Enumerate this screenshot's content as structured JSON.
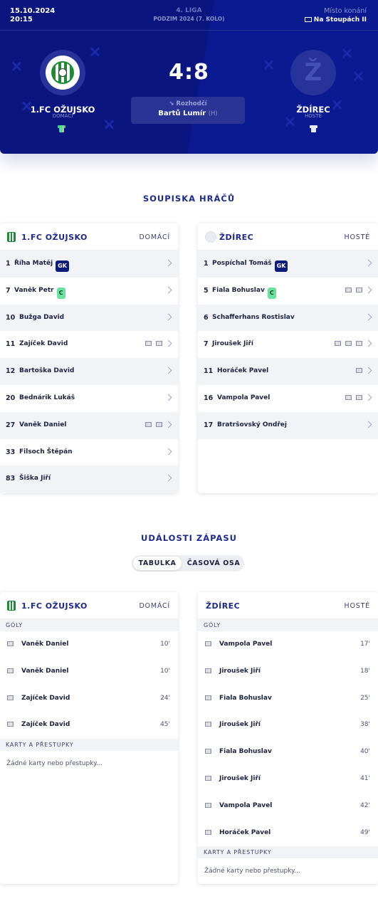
{
  "match": {
    "date": "15.10.2024",
    "time": "20:15",
    "league": "4. LIGA",
    "season": "PODZIM 2024 (7. KOLO)",
    "venue_label": "Místo konání",
    "venue": "Na Stoupách II",
    "score": "4:8",
    "referee_label": "Rozhodčí",
    "referee_name": "Bartů Lumír",
    "referee_role": "(H)",
    "home_name": "1.FC OŽUJSKO",
    "home_role": "DOMÁCÍ",
    "away_name": "ŽDÍREC",
    "away_role": "HOSTÉ",
    "away_logo_letter": "Ž",
    "colors": {
      "header_bg": "#0a1580",
      "accent": "#1c2a8c",
      "gk_badge": "#0f1b7a",
      "captain_badge": "#69e2a0"
    }
  },
  "lineups": {
    "title": "SOUPISKA HRÁČŮ",
    "home": {
      "title": "1.FC OŽUJSKO",
      "side": "DOMÁCÍ",
      "players": [
        {
          "num": "1",
          "name": "Říha Matěj",
          "tag": "GK",
          "goals": 0
        },
        {
          "num": "7",
          "name": "Vaněk Petr",
          "tag": "C",
          "goals": 0
        },
        {
          "num": "10",
          "name": "Bužga David",
          "tag": "",
          "goals": 0
        },
        {
          "num": "11",
          "name": "Zajíček David",
          "tag": "",
          "goals": 2
        },
        {
          "num": "12",
          "name": "Bartoška David",
          "tag": "",
          "goals": 0
        },
        {
          "num": "20",
          "name": "Bednárik Lukáš",
          "tag": "",
          "goals": 0
        },
        {
          "num": "27",
          "name": "Vaněk Daniel",
          "tag": "",
          "goals": 2
        },
        {
          "num": "33",
          "name": "Filsoch Štěpán",
          "tag": "",
          "goals": 0
        },
        {
          "num": "83",
          "name": "Šiška Jiří",
          "tag": "",
          "goals": 0
        }
      ]
    },
    "away": {
      "title": "ŽDÍREC",
      "side": "HOSTÉ",
      "players": [
        {
          "num": "1",
          "name": "Pospíchal Tomáš",
          "tag": "GK",
          "goals": 0
        },
        {
          "num": "5",
          "name": "Fiala Bohuslav",
          "tag": "C",
          "goals": 2
        },
        {
          "num": "6",
          "name": "Schafferhans Rostislav",
          "tag": "",
          "goals": 0
        },
        {
          "num": "7",
          "name": "Jiroušek Jiří",
          "tag": "",
          "goals": 3
        },
        {
          "num": "11",
          "name": "Horáček Pavel",
          "tag": "",
          "goals": 1
        },
        {
          "num": "16",
          "name": "Vampola Pavel",
          "tag": "",
          "goals": 2
        },
        {
          "num": "17",
          "name": "Bratršovský Ondřej",
          "tag": "",
          "goals": 0
        }
      ]
    }
  },
  "events": {
    "title": "UDÁLOSTI ZÁPASU",
    "toggle": [
      "TABULKA",
      "ČASOVÁ OSA"
    ],
    "goals_label": "GÓLY",
    "cards_label": "KARTY A PŘESTUPKY",
    "no_cards": "Žádné karty nebo přestupky...",
    "home": {
      "title": "1.FC OŽUJSKO",
      "side": "DOMÁCÍ",
      "goals": [
        {
          "name": "Vaněk Daniel",
          "min": "10'"
        },
        {
          "name": "Vaněk Daniel",
          "min": "10'"
        },
        {
          "name": "Zajíček David",
          "min": "24'"
        },
        {
          "name": "Zajíček David",
          "min": "45'"
        }
      ]
    },
    "away": {
      "title": "ŽDÍREC",
      "side": "HOSTÉ",
      "goals": [
        {
          "name": "Vampola Pavel",
          "min": "17'"
        },
        {
          "name": "Jiroušek Jiří",
          "min": "18'"
        },
        {
          "name": "Fiala Bohuslav",
          "min": "25'"
        },
        {
          "name": "Jiroušek Jiří",
          "min": "38'"
        },
        {
          "name": "Fiala Bohuslav",
          "min": "40'"
        },
        {
          "name": "Jiroušek Jiří",
          "min": "41'"
        },
        {
          "name": "Vampola Pavel",
          "min": "42'"
        },
        {
          "name": "Horáček Pavel",
          "min": "49'"
        }
      ]
    }
  }
}
